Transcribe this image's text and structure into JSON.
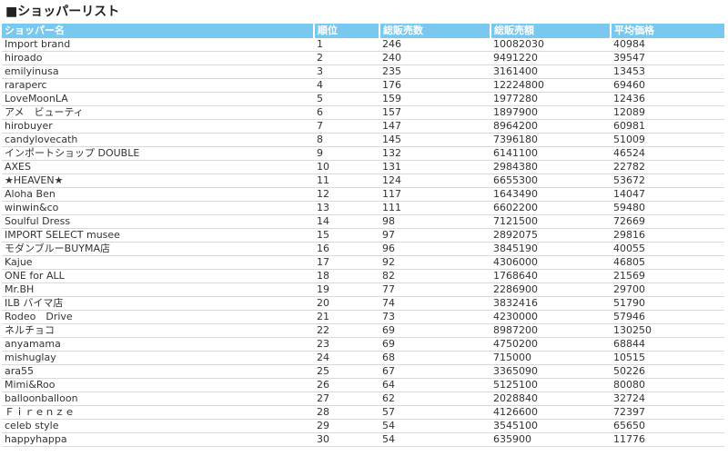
{
  "page": {
    "title": "■ショッパーリスト"
  },
  "table": {
    "headers": [
      "ショッパー名",
      "順位",
      "総販売数",
      "総販売額",
      "平均価格"
    ],
    "rows": [
      [
        "Import brand",
        "1",
        "246",
        "10082030",
        "40984"
      ],
      [
        "hiroado",
        "2",
        "240",
        "9491220",
        "39547"
      ],
      [
        "emilyinusa",
        "3",
        "235",
        "3161400",
        "13453"
      ],
      [
        "raraperc",
        "4",
        "176",
        "12224800",
        "69460"
      ],
      [
        "LoveMoonLA",
        "5",
        "159",
        "1977280",
        "12436"
      ],
      [
        "アメ　ビューティ",
        "6",
        "157",
        "1897900",
        "12089"
      ],
      [
        "hirobuyer",
        "7",
        "147",
        "8964200",
        "60981"
      ],
      [
        "candylovecath",
        "8",
        "145",
        "7396180",
        "51009"
      ],
      [
        "インポートショップ DOUBLE",
        "9",
        "132",
        "6141100",
        "46524"
      ],
      [
        "AXES",
        "10",
        "131",
        "2984380",
        "22782"
      ],
      [
        "★HEAVEN★",
        "11",
        "124",
        "6655300",
        "53672"
      ],
      [
        "Aloha Ben",
        "12",
        "117",
        "1643490",
        "14047"
      ],
      [
        "winwin&co",
        "13",
        "111",
        "6602200",
        "59480"
      ],
      [
        "Soulful Dress",
        "14",
        "98",
        "7121500",
        "72669"
      ],
      [
        "IMPORT SELECT musee",
        "15",
        "97",
        "2892075",
        "29816"
      ],
      [
        "モダンブルーBUYMA店",
        "16",
        "96",
        "3845190",
        "40055"
      ],
      [
        "Kajue",
        "17",
        "92",
        "4306000",
        "46805"
      ],
      [
        "ONE for ALL",
        "18",
        "82",
        "1768640",
        "21569"
      ],
      [
        "Mr.BH",
        "19",
        "77",
        "2286900",
        "29700"
      ],
      [
        "ILB バイマ店",
        "20",
        "74",
        "3832416",
        "51790"
      ],
      [
        "Rodeo　Drive",
        "21",
        "73",
        "4230000",
        "57946"
      ],
      [
        "ネルチョコ",
        "22",
        "69",
        "8987200",
        "130250"
      ],
      [
        "anyamama",
        "23",
        "69",
        "4750200",
        "68844"
      ],
      [
        "mishuglay",
        "24",
        "68",
        "715000",
        "10515"
      ],
      [
        "ara55",
        "25",
        "67",
        "3365090",
        "50226"
      ],
      [
        "Mimi&Roo",
        "26",
        "64",
        "5125100",
        "80080"
      ],
      [
        "balloonballoon",
        "27",
        "62",
        "2028840",
        "32724"
      ],
      [
        "Ｆｉｒｅｎｚｅ",
        "28",
        "57",
        "4126600",
        "72397"
      ],
      [
        "celeb style",
        "29",
        "54",
        "3545100",
        "65650"
      ],
      [
        "happyhappa",
        "30",
        "54",
        "635900",
        "11776"
      ]
    ]
  },
  "colors": {
    "header_background": "#79c8ef",
    "header_text": "#ffffff",
    "row_divider": "#d9d9d9",
    "body_text": "#333333"
  }
}
